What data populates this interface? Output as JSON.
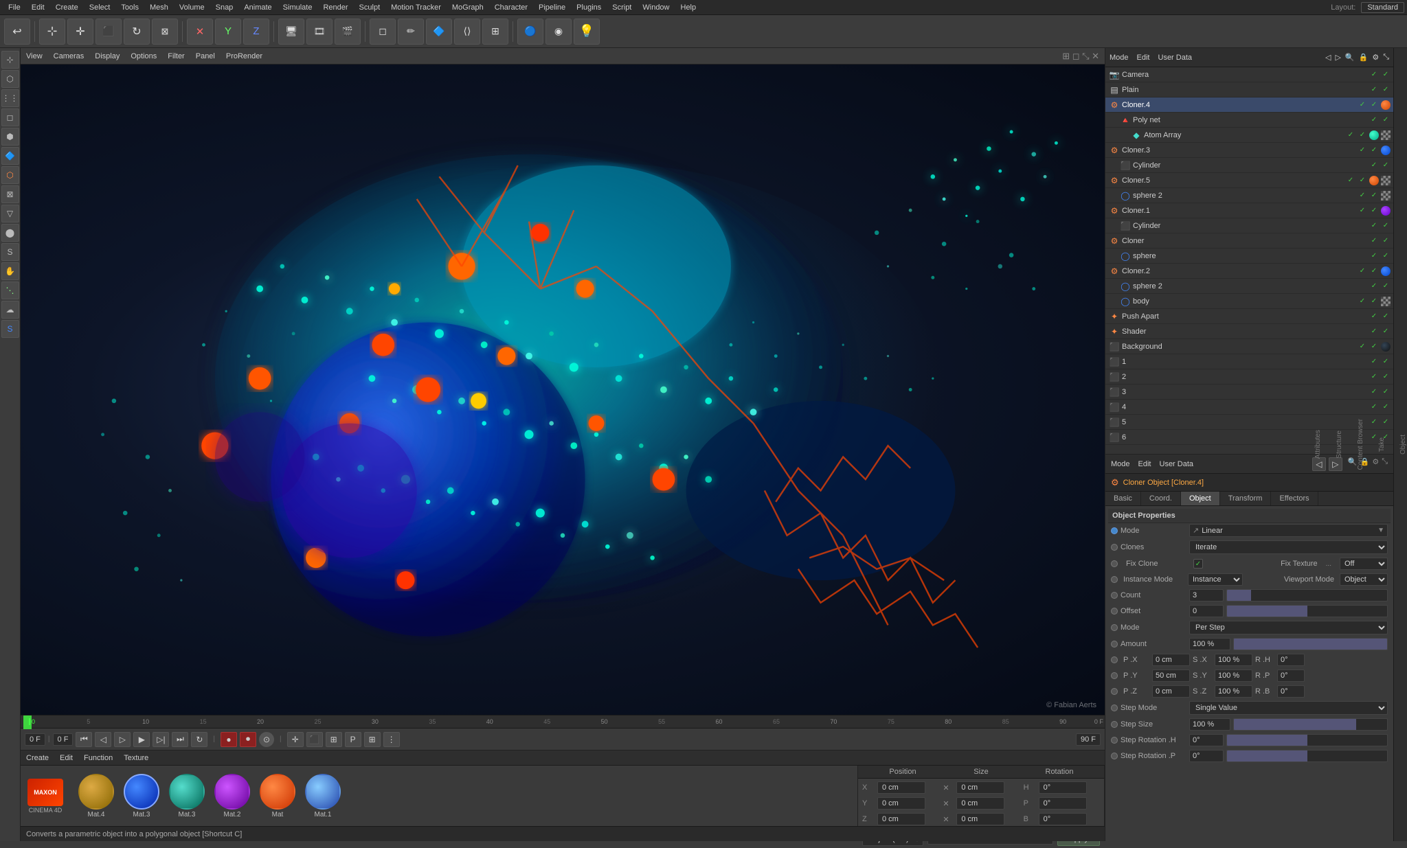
{
  "app": {
    "title": "Cinema 4D",
    "layout": "Standard"
  },
  "menu": {
    "items": [
      "File",
      "Edit",
      "Create",
      "Select",
      "Tools",
      "Mesh",
      "Volume",
      "Snap",
      "Animate",
      "Simulate",
      "Render",
      "Sculpt",
      "Motion Tracker",
      "MoGraph",
      "Character",
      "Pipeline",
      "Plugins",
      "Script",
      "Window",
      "Help"
    ]
  },
  "viewport_header": {
    "items": [
      "View",
      "Cameras",
      "Display",
      "Options",
      "Filter",
      "Panel",
      "ProRender"
    ]
  },
  "object_list": {
    "items": [
      {
        "name": "Camera",
        "indent": 0,
        "icon": "📷",
        "flags": [
          "eye",
          "lock",
          "check"
        ],
        "mat": null
      },
      {
        "name": "Plain",
        "indent": 0,
        "icon": "▤",
        "flags": [
          "eye",
          "lock",
          "check"
        ],
        "mat": null
      },
      {
        "name": "Cloner.4",
        "indent": 0,
        "icon": "⚙",
        "flags": [
          "eye",
          "lock",
          "check"
        ],
        "mat": "orange",
        "selected": true
      },
      {
        "name": "Poly net",
        "indent": 1,
        "icon": "🔺",
        "flags": [
          "eye",
          "lock",
          "check"
        ],
        "mat": null
      },
      {
        "name": "Atom Array",
        "indent": 2,
        "icon": "🔷",
        "flags": [
          "eye",
          "lock",
          "check"
        ],
        "mat": "teal"
      },
      {
        "name": "Cloner.3",
        "indent": 0,
        "icon": "⚙",
        "flags": [
          "eye",
          "lock",
          "check"
        ],
        "mat": "blue"
      },
      {
        "name": "Cylinder",
        "indent": 1,
        "icon": "⬛",
        "flags": [
          "eye",
          "lock",
          "check"
        ],
        "mat": null
      },
      {
        "name": "Cloner.5",
        "indent": 0,
        "icon": "⚙",
        "flags": [
          "eye",
          "lock",
          "check"
        ],
        "mat": "orange"
      },
      {
        "name": "sphere 2",
        "indent": 1,
        "icon": "◯",
        "flags": [
          "eye",
          "lock",
          "check"
        ],
        "mat": "checker"
      },
      {
        "name": "Cloner.1",
        "indent": 0,
        "icon": "⚙",
        "flags": [
          "eye",
          "lock",
          "check"
        ],
        "mat": "purple"
      },
      {
        "name": "Cylinder",
        "indent": 1,
        "icon": "⬛",
        "flags": [
          "eye",
          "lock",
          "check"
        ],
        "mat": null
      },
      {
        "name": "Cloner",
        "indent": 0,
        "icon": "⚙",
        "flags": [
          "eye",
          "lock",
          "check"
        ],
        "mat": null
      },
      {
        "name": "sphere",
        "indent": 1,
        "icon": "◯",
        "flags": [
          "eye",
          "lock",
          "check"
        ],
        "mat": null
      },
      {
        "name": "Cloner.2",
        "indent": 0,
        "icon": "⚙",
        "flags": [
          "eye",
          "lock",
          "check"
        ],
        "mat": "blue"
      },
      {
        "name": "sphere 2",
        "indent": 1,
        "icon": "◯",
        "flags": [
          "eye",
          "lock",
          "check"
        ],
        "mat": null
      },
      {
        "name": "body",
        "indent": 1,
        "icon": "◯",
        "flags": [
          "eye",
          "lock",
          "check"
        ],
        "mat": "checker"
      },
      {
        "name": "Push Apart",
        "indent": 0,
        "icon": "✦",
        "flags": [
          "eye",
          "lock",
          "check"
        ],
        "mat": null
      },
      {
        "name": "Shader",
        "indent": 0,
        "icon": "✦",
        "flags": [
          "eye",
          "lock",
          "check"
        ],
        "mat": null
      },
      {
        "name": "Background",
        "indent": 0,
        "icon": "⬛",
        "flags": [
          "eye",
          "lock",
          "check"
        ],
        "mat": "dark"
      },
      {
        "name": "1",
        "indent": 0,
        "icon": "⬛",
        "flags": [
          "eye",
          "lock",
          "check"
        ],
        "mat": null
      },
      {
        "name": "2",
        "indent": 0,
        "icon": "⬛",
        "flags": [
          "eye",
          "lock",
          "check"
        ],
        "mat": null
      },
      {
        "name": "3",
        "indent": 0,
        "icon": "⬛",
        "flags": [
          "eye",
          "lock",
          "check"
        ],
        "mat": null
      },
      {
        "name": "4",
        "indent": 0,
        "icon": "⬛",
        "flags": [
          "eye",
          "lock",
          "check"
        ],
        "mat": null
      },
      {
        "name": "5",
        "indent": 0,
        "icon": "⬛",
        "flags": [
          "eye",
          "lock",
          "check"
        ],
        "mat": null
      },
      {
        "name": "6",
        "indent": 0,
        "icon": "⬛",
        "flags": [
          "eye",
          "lock",
          "check"
        ],
        "mat": null
      }
    ]
  },
  "attributes": {
    "panel_title": "Cloner Object [Cloner.4]",
    "tabs": [
      "Basic",
      "Coord.",
      "Object",
      "Transform",
      "Effectors"
    ],
    "active_tab": "Object",
    "section_title": "Object Properties",
    "mode": {
      "label": "Mode",
      "value": "Linear",
      "icon": "linear-icon"
    },
    "clones": {
      "label": "Clones",
      "value": "Iterate"
    },
    "fix_clone": {
      "label": "Fix Clone",
      "checked": true
    },
    "fix_texture": {
      "label": "Fix Texture",
      "value": "Off"
    },
    "instance_mode": {
      "label": "Instance Mode",
      "value": "Instance"
    },
    "viewport_mode": {
      "label": "Viewport Mode",
      "value": "Object"
    },
    "count": {
      "label": "Count",
      "value": "3"
    },
    "offset": {
      "label": "Offset",
      "value": "0"
    },
    "mode2": {
      "label": "Mode",
      "value": "Per Step"
    },
    "amount": {
      "label": "Amount",
      "value": "100 %"
    },
    "p_x": {
      "label": "P .X",
      "value": "0 cm"
    },
    "p_y": {
      "label": "P .Y",
      "value": "50 cm"
    },
    "p_z": {
      "label": "P .Z",
      "value": "0 cm"
    },
    "s_x": {
      "label": "S .X",
      "value": "100 %"
    },
    "s_y": {
      "label": "S .Y",
      "value": "100 %"
    },
    "s_z": {
      "label": "S .Z",
      "value": "100 %"
    },
    "r_h": {
      "label": "R .H",
      "value": "0°"
    },
    "r_p": {
      "label": "R .P",
      "value": "0°"
    },
    "r_b": {
      "label": "R .B",
      "value": "0°"
    },
    "step_mode": {
      "label": "Step Mode",
      "value": "Single Value"
    },
    "step_size": {
      "label": "Step Size",
      "value": "100 %"
    },
    "step_rotation_h": {
      "label": "Step Rotation .H",
      "value": "0°"
    },
    "step_rotation_p": {
      "label": "Step Rotation .P",
      "value": "0°"
    }
  },
  "coordinates": {
    "header": {
      "position": "Position",
      "size": "Size",
      "rotation": "Rotation"
    },
    "x_pos": "0 cm",
    "y_pos": "0 cm",
    "z_pos": "0 cm",
    "x_size": "0 cm",
    "y_size": "0 cm",
    "z_size": "0 cm",
    "h_rot": "0°",
    "p_rot": "0°",
    "b_rot": "0°",
    "mode": "Object (Rel)",
    "apply": "Apply"
  },
  "timeline": {
    "current_frame": "0 F",
    "start_frame": "0 F",
    "end_frame": "90 F",
    "markers": [
      "0",
      "",
      "10",
      "",
      "20",
      "",
      "30",
      "",
      "40",
      "",
      "50",
      "",
      "60",
      "",
      "70",
      "",
      "80",
      "",
      "90"
    ],
    "fps_label": "0 F"
  },
  "materials": {
    "toolbar": [
      "Create",
      "Edit",
      "Function",
      "Texture"
    ],
    "items": [
      {
        "name": "Mat.4",
        "type": "gold"
      },
      {
        "name": "Mat.3",
        "type": "blue",
        "selected": true
      },
      {
        "name": "Mat.3",
        "type": "teal"
      },
      {
        "name": "Mat.2",
        "type": "purple"
      },
      {
        "name": "Mat",
        "type": "orange"
      },
      {
        "name": "Mat.1",
        "type": "light-blue"
      }
    ]
  },
  "status_bar": {
    "text": "Converts a parametric object into a polygonal object [Shortcut C]"
  },
  "watermark": "© Fabian Aerts"
}
